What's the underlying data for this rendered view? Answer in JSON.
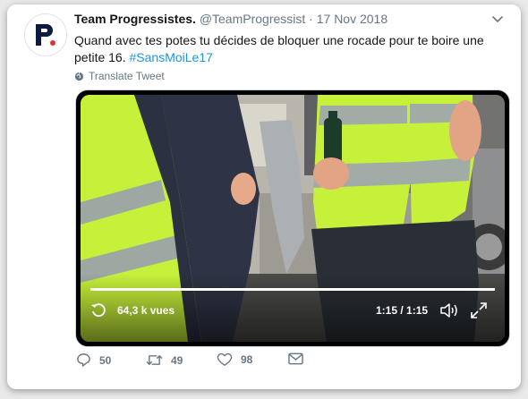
{
  "tweet": {
    "display_name": "Team Progressistes.",
    "handle": "@TeamProgressist",
    "separator": "·",
    "date": "17 Nov 2018",
    "text": "Quand avec tes potes tu décides de bloquer une rocade pour te boire une petite 16.",
    "hashtag": "#SansMoiLe17",
    "translate_label": "Translate Tweet",
    "avatar_letter": "P."
  },
  "video": {
    "views": "64,3 k vues",
    "timecode": "1:15 / 1:15",
    "progress": 1.0
  },
  "actions": {
    "reply_count": "50",
    "retweet_count": "49",
    "like_count": "98"
  },
  "colors": {
    "link": "#1b95e0",
    "secondary": "#657786",
    "vest": "#c6f03a"
  },
  "icons": [
    "chevron-down-icon",
    "globe-icon",
    "replay-icon",
    "volume-icon",
    "fullscreen-icon",
    "reply-icon",
    "retweet-icon",
    "like-icon",
    "message-icon"
  ]
}
